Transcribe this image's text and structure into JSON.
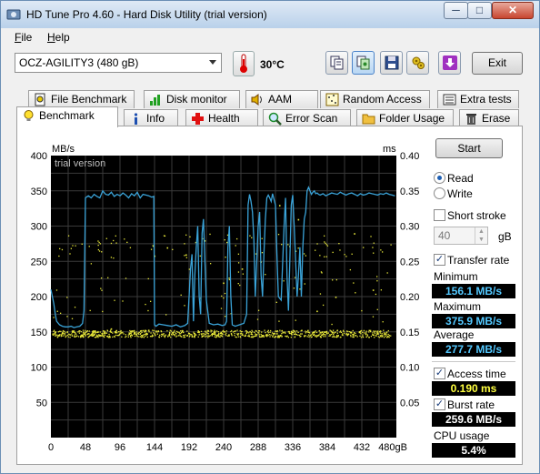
{
  "window": {
    "title": "HD Tune Pro 4.60 - Hard Disk Utility (trial version)",
    "min_glyph": "─",
    "max_glyph": "□",
    "close_glyph": "✕"
  },
  "menu": {
    "file_u": "F",
    "file_rest": "ile",
    "help_u": "H",
    "help_rest": "elp"
  },
  "toolbar": {
    "drive": "OCZ-AGILITY3 (480 gB)",
    "temperature": "30°C",
    "buttons": [
      "copy-info-icon",
      "copy-screenshot-icon",
      "save-icon",
      "options-icon",
      "download-icon"
    ],
    "exit_label": "Exit"
  },
  "tabs_top": [
    "File Benchmark",
    "Disk monitor",
    "AAM",
    "Random Access",
    "Extra tests"
  ],
  "tabs_bottom": [
    "Benchmark",
    "Info",
    "Health",
    "Error Scan",
    "Folder Usage",
    "Erase"
  ],
  "active_tab": "Benchmark",
  "side": {
    "start_label": "Start",
    "read_label": "Read",
    "write_label": "Write",
    "read_selected": true,
    "short_stroke_label": "Short stroke",
    "short_stroke_checked": false,
    "short_stroke_value": "40",
    "short_stroke_unit": "gB",
    "transfer_rate_label": "Transfer rate",
    "transfer_rate_checked": true,
    "minimum_label": "Minimum",
    "minimum_value": "156.1 MB/s",
    "maximum_label": "Maximum",
    "maximum_value": "375.9 MB/s",
    "average_label": "Average",
    "average_value": "277.7 MB/s",
    "access_time_label": "Access time",
    "access_time_checked": true,
    "access_time_value": "0.190 ms",
    "burst_rate_label": "Burst rate",
    "burst_rate_checked": true,
    "burst_rate_value": "259.6 MB/s",
    "cpu_usage_label": "CPU usage",
    "cpu_usage_value": "5.4%"
  },
  "chart_data": {
    "type": "line",
    "watermark": "trial version",
    "ylabel_left": "MB/s",
    "ylabel_right": "ms",
    "xlim": [
      0,
      480
    ],
    "ylim_left": [
      0,
      400
    ],
    "ylim_right": [
      0,
      0.4
    ],
    "x_ticks": [
      "0",
      "48",
      "96",
      "144",
      "192",
      "240",
      "288",
      "336",
      "384",
      "432",
      "480gB"
    ],
    "y_left_ticks": [
      "50",
      "100",
      "150",
      "200",
      "250",
      "300",
      "350",
      "400"
    ],
    "y_right_ticks": [
      "0.05",
      "0.10",
      "0.15",
      "0.20",
      "0.25",
      "0.30",
      "0.35",
      "0.40"
    ],
    "grid": true,
    "colors": {
      "background": "#000000",
      "grid": "#3a3a3a",
      "transfer": "#3aa3d8",
      "access": "#e8e83a"
    },
    "series": [
      {
        "name": "Transfer rate",
        "x": [
          0,
          2,
          4,
          6,
          8,
          12,
          16,
          20,
          24,
          28,
          32,
          36,
          40,
          44,
          46,
          48,
          52,
          56,
          60,
          64,
          68,
          72,
          76,
          80,
          84,
          88,
          92,
          96,
          100,
          104,
          108,
          112,
          116,
          120,
          124,
          128,
          132,
          136,
          140,
          143,
          144,
          146,
          150,
          156,
          162,
          168,
          174,
          180,
          186,
          190,
          192,
          194,
          196,
          198,
          200,
          202,
          204,
          206,
          208,
          210,
          212,
          214,
          216,
          220,
          226,
          232,
          238,
          242,
          244,
          246,
          248,
          250,
          252,
          256,
          262,
          268,
          272,
          274,
          276,
          278,
          280,
          282,
          284,
          286,
          288,
          290,
          292,
          294,
          296,
          298,
          300,
          302,
          304,
          306,
          308,
          310,
          312,
          314,
          316,
          320,
          324,
          326,
          328,
          330,
          332,
          334,
          336,
          338,
          340,
          342,
          344,
          346,
          348,
          350,
          352,
          354,
          356,
          358,
          360,
          362,
          364,
          366,
          368,
          370,
          372,
          374,
          378,
          382,
          386,
          390,
          394,
          398,
          402,
          406,
          410,
          414,
          418,
          422,
          426,
          430,
          434,
          438,
          442,
          446,
          450,
          454,
          458,
          462,
          466,
          470,
          474,
          478
        ],
        "values": [
          210,
          200,
          190,
          175,
          165,
          160,
          158,
          157,
          157,
          158,
          156,
          157,
          158,
          162,
          180,
          340,
          343,
          340,
          345,
          342,
          340,
          350,
          345,
          344,
          348,
          342,
          345,
          343,
          347,
          344,
          340,
          346,
          343,
          348,
          340,
          345,
          344,
          343,
          341,
          342,
          160,
          158,
          161,
          160,
          159,
          158,
          160,
          157,
          159,
          162,
          200,
          240,
          260,
          165,
          230,
          270,
          300,
          200,
          175,
          290,
          310,
          250,
          195,
          162,
          160,
          161,
          159,
          160,
          165,
          270,
          300,
          200,
          160,
          158,
          160,
          162,
          175,
          330,
          345,
          335,
          320,
          280,
          200,
          250,
          300,
          320,
          230,
          200,
          260,
          310,
          340,
          344,
          340,
          335,
          346,
          338,
          330,
          260,
          200,
          195,
          300,
          340,
          230,
          180,
          250,
          330,
          344,
          300,
          250,
          200,
          230,
          270,
          200,
          270,
          310,
          320,
          350,
          355,
          350,
          345,
          348,
          350,
          346,
          347,
          345,
          344,
          346,
          343,
          345,
          347,
          346,
          345,
          348,
          346,
          344,
          346,
          347,
          345,
          343,
          346,
          344,
          345,
          347,
          346,
          345,
          344,
          346,
          345,
          347,
          345,
          344,
          343
        ]
      }
    ],
    "access_time_points_ms": [
      0.15,
      0.152,
      0.151,
      0.155,
      0.149,
      0.153,
      0.27,
      0.26,
      0.28,
      0.22,
      0.24,
      0.25,
      0.33,
      0.31,
      0.18,
      0.2,
      0.29,
      0.21
    ],
    "average_line_mbs": 277.7
  }
}
